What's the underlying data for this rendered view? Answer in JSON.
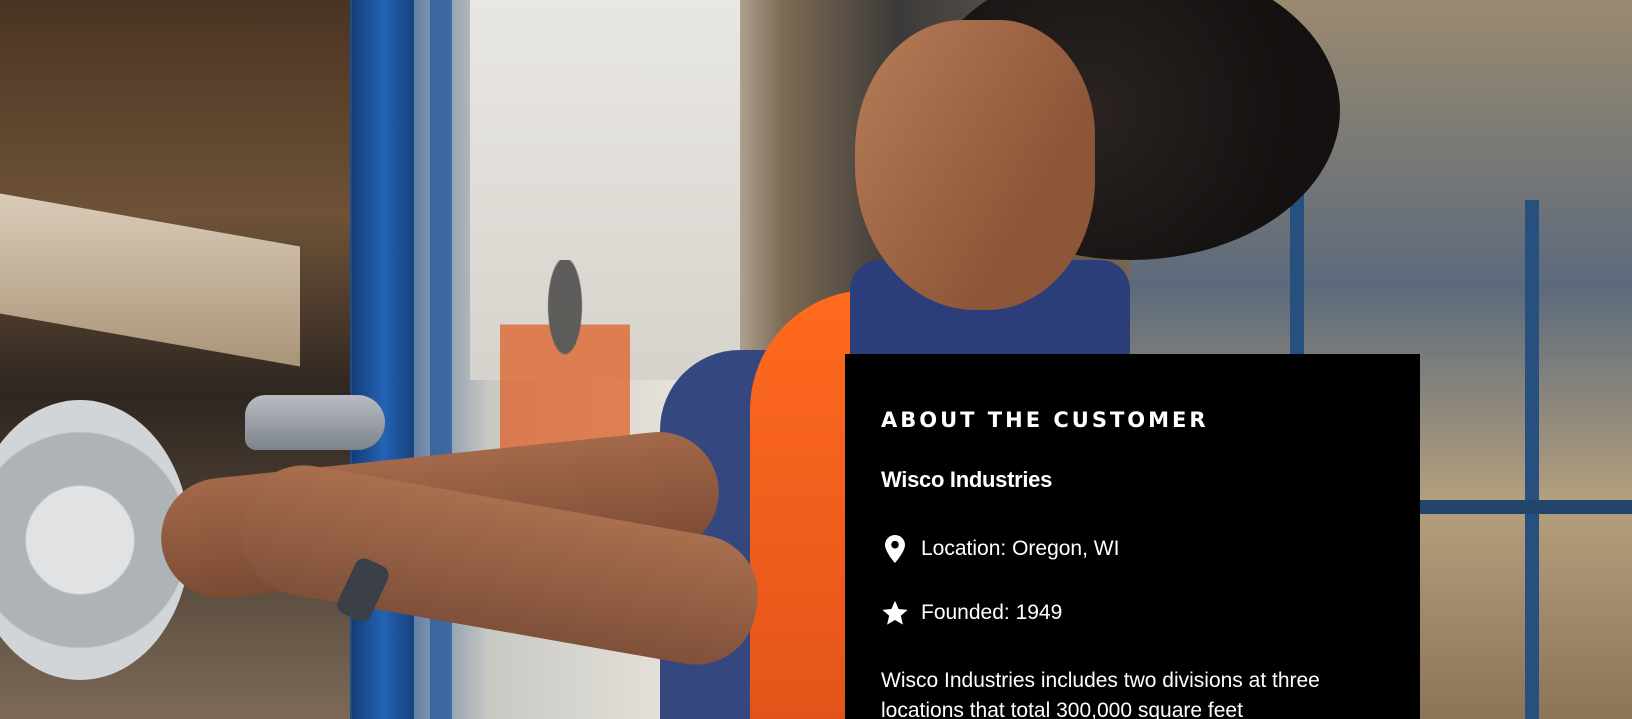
{
  "customer": {
    "heading": "ABOUT THE CUSTOMER",
    "company_name": "Wisco Industries",
    "location": {
      "icon": "map-pin-icon",
      "text": "Location: Oregon, WI"
    },
    "founded": {
      "icon": "star-icon",
      "text": "Founded: 1949"
    },
    "description": "Wisco Industries includes two divisions at three locations that total 300,000 square feet"
  },
  "colors": {
    "card_background": "#000000",
    "card_text": "#ffffff",
    "vest_orange": "#ff6a1f",
    "rack_blue": "#2463b4"
  }
}
